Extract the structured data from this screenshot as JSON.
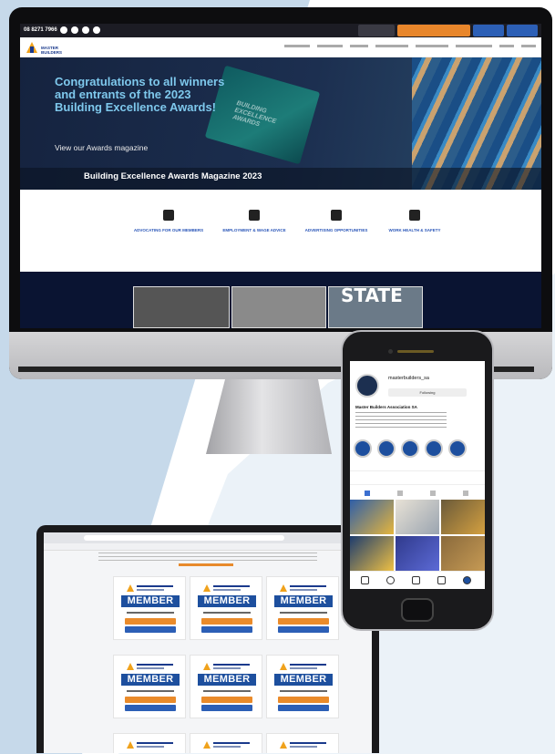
{
  "desktop": {
    "topbar": {
      "phone": "08 8271 7966",
      "buttons": [
        {
          "label": "",
          "color": "#3a3a44"
        },
        {
          "label": "",
          "color": "#e8862b"
        },
        {
          "label": "",
          "color": "#2c5fb6"
        },
        {
          "label": "",
          "color": "#2c5fb6"
        }
      ]
    },
    "nav": {
      "logo_text": "MASTER BUILDERS",
      "menu": [
        "",
        "",
        "",
        "",
        "",
        "",
        "",
        ""
      ]
    },
    "hero": {
      "title": "Congratulations to all winners and entrants of the 2023 Building Excellence Awards!",
      "subtitle": "View our Awards magazine",
      "magazine_cover_text": "BUILDING EXCELLENCE AWARDS",
      "banner_label": "Building Excellence Awards Magazine 2023"
    },
    "features": [
      {
        "label": "ADVOCATING FOR OUR MEMBERS",
        "icon": "megaphone-icon"
      },
      {
        "label": "EMPLOYMENT & WAGE ADVICE",
        "icon": "worker-icon"
      },
      {
        "label": "ADVERTISING OPPORTUNITIES",
        "icon": "play-icon"
      },
      {
        "label": "WORK HEALTH & SAFETY",
        "icon": "heart-icon"
      }
    ],
    "footer_band": {
      "state_text": "STATE"
    }
  },
  "laptop": {
    "members": [
      {
        "badge": "MEMBER"
      },
      {
        "badge": "MEMBER"
      },
      {
        "badge": "MEMBER"
      },
      {
        "badge": "MEMBER"
      },
      {
        "badge": "MEMBER"
      },
      {
        "badge": "MEMBER"
      }
    ]
  },
  "phone": {
    "instagram": {
      "handle": "masterbuilders_sa",
      "follow_label": "Following",
      "name": "Master Builders Association SA",
      "highlights": [
        "",
        "",
        "",
        "",
        ""
      ],
      "stats": [
        {
          "value": "",
          "label": ""
        },
        {
          "value": "",
          "label": ""
        },
        {
          "value": "",
          "label": ""
        }
      ]
    }
  },
  "colors": {
    "background": "#c6d9ea",
    "brand_blue": "#1d4f9e",
    "brand_orange": "#ea8b2a",
    "hero_title": "#7ec8ec",
    "navy": "#0a1432"
  }
}
